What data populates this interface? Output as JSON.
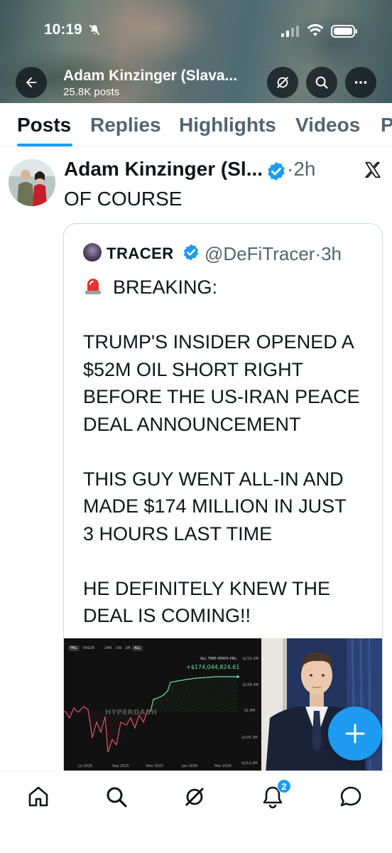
{
  "status_bar": {
    "time": "10:19"
  },
  "header": {
    "title": "Adam Kinzinger (Slava...",
    "post_count": "25.8K posts"
  },
  "tabs": [
    {
      "label": "Posts",
      "active": true
    },
    {
      "label": "Replies",
      "active": false
    },
    {
      "label": "Highlights",
      "active": false
    },
    {
      "label": "Videos",
      "active": false
    },
    {
      "label": "P",
      "active": false
    }
  ],
  "post": {
    "author": "Adam Kinzinger (Sl...",
    "time": "·2h",
    "text": "OF COURSE"
  },
  "quote": {
    "name": "TRACER",
    "handle_time": "@DeFiTracer·3h",
    "lines": [
      "BREAKING:",
      "",
      "TRUMP'S INSIDER OPENED A",
      "$52M OIL SHORT RIGHT",
      "BEFORE THE US-IRAN PEACE",
      "DEAL ANNOUNCEMENT",
      "",
      "THIS GUY WENT ALL-IN AND",
      "MADE $174 MILLION IN JUST",
      "3 HOURS LAST TIME",
      "",
      "HE DEFINITELY KNEW THE",
      "DEAL IS COMING!!"
    ]
  },
  "media": {
    "chart_tabs": [
      "PNL",
      "VALUE",
      "24H",
      "1W",
      "1M",
      "ALL"
    ],
    "chart_heading": "ALL TIME PERPS PNL",
    "chart_value": "+$174,044,824.61",
    "watermark": "HYPERDASH",
    "y_ticks": [
      "$215.2M",
      "$108.4M",
      "$1.6M",
      "-$105.2M",
      "-$212.0M"
    ],
    "x_ticks": [
      "Jul 2025",
      "Sep 2025",
      "Nov 2025",
      "Jan 2026",
      "Mar 2026"
    ]
  },
  "nav": {
    "notification_count": "2"
  },
  "colors": {
    "accent": "#1d9bf0",
    "text_primary": "#0f1419",
    "text_secondary": "#536471",
    "chart_positive": "#6fe09a",
    "chart_negative": "#e0556a"
  }
}
